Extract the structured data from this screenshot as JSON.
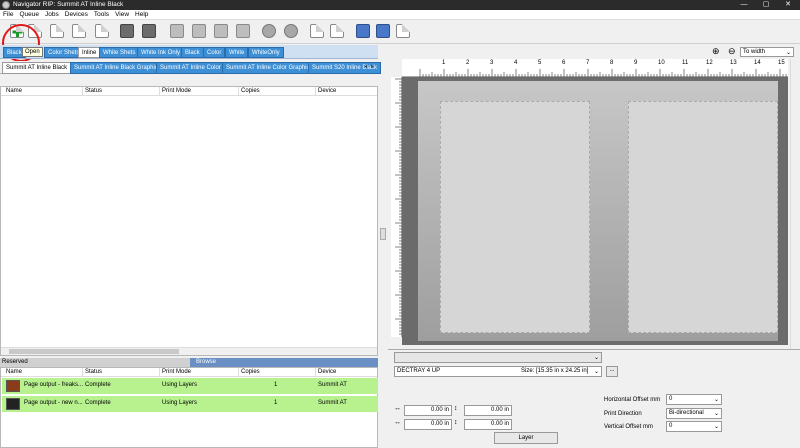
{
  "window": {
    "title": "Navigator RIP: Summit AT Inline Black",
    "controls": [
      "—",
      "▢",
      "✕"
    ]
  },
  "menu": [
    "File",
    "Queue",
    "Jobs",
    "Devices",
    "Tools",
    "View",
    "Help"
  ],
  "toolbar": {
    "tooltip": "Open"
  },
  "queue_tabs": [
    "Black",
    "Open",
    "Color Shets",
    "Inline",
    "White Shets",
    "White Ink Only",
    "Black",
    "Color",
    "White",
    "WhiteOnly"
  ],
  "printer_tabs": [
    "Summit AT Inline Black",
    "Summit AT Inline Black Graphics",
    "Summit AT Inline Color",
    "Summit AT Inline Color Graphics",
    "Summit S20 Inline Black"
  ],
  "top_table": {
    "columns": [
      "Name",
      "Status",
      "Print Mode",
      "Copies",
      "Device"
    ]
  },
  "bottom_tabs": {
    "reserved": "Reserved",
    "browse": "Browse"
  },
  "bottom_table": {
    "columns": [
      "Name",
      "Status",
      "Print Mode",
      "Copies",
      "Device"
    ],
    "rows": [
      {
        "name": "Page output - freaks...",
        "status": "Complete",
        "mode": "Using Layers",
        "copies": "1",
        "device": "Summit AT"
      },
      {
        "name": "Page output - new n...",
        "status": "Complete",
        "mode": "Using Layers",
        "copies": "1",
        "device": "Summit AT"
      }
    ]
  },
  "zoom": {
    "value": "To width"
  },
  "ruler": [
    "1",
    "2",
    "3",
    "4",
    "5",
    "6",
    "7",
    "8",
    "9",
    "10",
    "11",
    "12",
    "13",
    "14",
    "15"
  ],
  "layout": {
    "tray_label": "DECTRAY 4 UP",
    "size_text": "Size: [15.35 in x 24.25 in]",
    "more_btn": "...",
    "offsets": [
      "0.00 in",
      "0.00 in",
      "0.00 in",
      "0.00 in"
    ],
    "layer_btn": "Layer",
    "horizontal_offset_label": "Horizontal Offset mm",
    "horizontal_offset": "0",
    "print_direction_label": "Print Direction",
    "print_direction": "Bi-directional",
    "vertical_offset_label": "Vertical Offset mm",
    "vertical_offset": "0"
  }
}
